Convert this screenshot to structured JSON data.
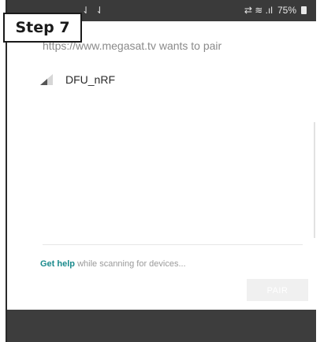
{
  "badge": {
    "label": "Step 7"
  },
  "status_bar": {
    "left_icons": "⇃ ⇃",
    "right_icons": "⇄ ≋ .ıl",
    "battery_text": "75%"
  },
  "dialog": {
    "title": "https://www.megasat.tv wants to pair",
    "devices": [
      {
        "name": "DFU_nRF",
        "icon": "signal-strength-icon"
      }
    ],
    "help_link": "Get help",
    "help_text": " while scanning for devices...",
    "pair_label": "PAIR"
  },
  "colors": {
    "link": "#1a8a8c",
    "status_bar": "#3a3a3a",
    "nav_bar": "#3d3d3d"
  }
}
